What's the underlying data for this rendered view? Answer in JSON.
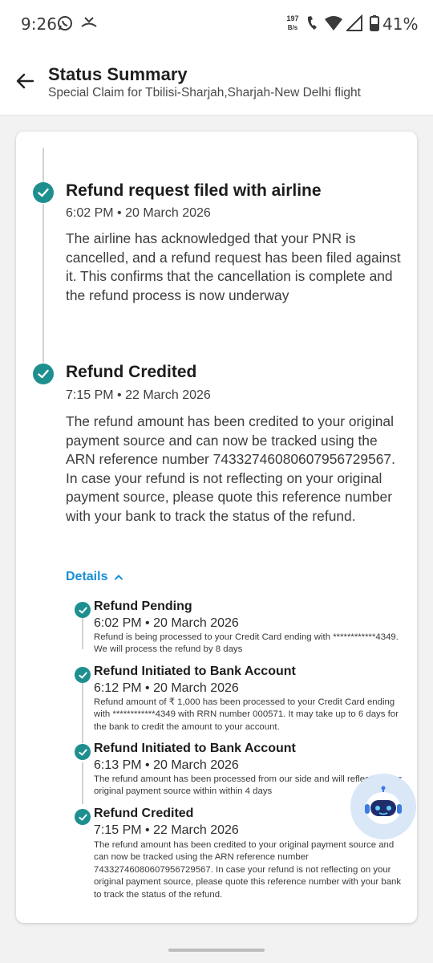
{
  "status_bar": {
    "time": "9:26",
    "net_speed_value": "197",
    "net_speed_unit": "B/s",
    "battery": "41%"
  },
  "header": {
    "title": "Status Summary",
    "subtitle": "Special Claim for Tbilisi-Sharjah,Sharjah-New Delhi flight"
  },
  "steps": [
    {
      "title": "Refund request filed with airline",
      "time": "6:02 PM • 20 March 2026",
      "description": "The airline has acknowledged that your PNR is cancelled, and a refund request has been filed against it. This confirms that the cancellation is complete and the refund process is now underway"
    },
    {
      "title": "Refund Credited",
      "time": "7:15 PM • 22 March 2026",
      "description": "The refund amount has been credited to your original payment source and can now be tracked using the ARN reference number 74332746080607956729567. In case your refund is not reflecting on your original payment source, please quote this reference number with your bank to track the status of the refund."
    }
  ],
  "details": {
    "label": "Details",
    "items": [
      {
        "title": "Refund Pending",
        "time": "6:02 PM • 20 March 2026",
        "description": "Refund is being processed to your Credit Card ending with ************4349. We will process the refund by 8 days"
      },
      {
        "title": "Refund Initiated to Bank Account",
        "time": "6:12 PM • 20 March 2026",
        "description": "Refund amount of ₹ 1,000 has been processed to your Credit Card ending with ************4349 with RRN number 000571. It may take up to 6 days for the bank to credit the amount to your account."
      },
      {
        "title": "Refund Initiated to Bank Account",
        "time": "6:13 PM • 20 March 2026",
        "description": "The refund amount has been processed from our side and will reflect in your original payment source within within 4 days"
      },
      {
        "title": "Refund Credited",
        "time": "7:15 PM • 22 March 2026",
        "description": "The refund amount has been credited to your original payment source and can now be tracked using the ARN reference number 74332746080607956729567. In case your refund is not reflecting on your original payment source, please quote this reference number with your bank to track the status of the refund."
      }
    ]
  },
  "colors": {
    "accent_teal": "#1e8f8f",
    "link_blue": "#1a8fd6"
  }
}
